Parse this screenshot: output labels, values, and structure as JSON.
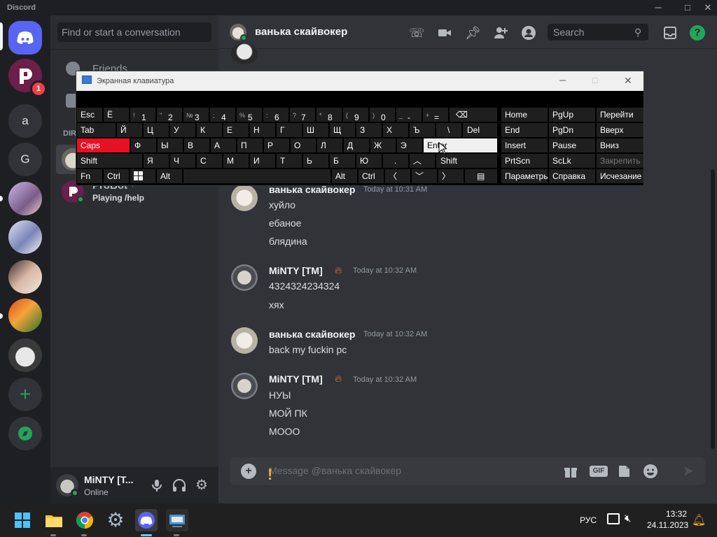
{
  "window": {
    "app_name": "Discord"
  },
  "guilds": {
    "badge": "1",
    "text_icons": [
      "a",
      "G"
    ]
  },
  "sidebar": {
    "search_placeholder": "Find or start a conversation",
    "friends_label": "Friends",
    "dm_header": "DIRE",
    "probot": {
      "name": "ProBot",
      "status": "Playing /help"
    }
  },
  "user_panel": {
    "name": "MiNTY [T...",
    "status": "Online"
  },
  "chat_header": {
    "name": "ванька скайвокер",
    "search_placeholder": "Search"
  },
  "messages": [
    {
      "author": "ванька скайвокер",
      "time": "Today at 10:31 AM",
      "lines": [
        "хуйло",
        "ебаное",
        "блядина"
      ]
    },
    {
      "author": "MiNTY [TM]",
      "time": "Today at 10:32 AM",
      "lines": [
        "4324324234324",
        "хях"
      ]
    },
    {
      "author": "ванька скайвокер",
      "time": "Today at 10:32 AM",
      "lines": [
        "back my fuckin pc"
      ]
    },
    {
      "author": "MiNTY [TM]",
      "time": "Today at 10:32 AM",
      "lines": [
        "НУЫ",
        "МОЙ ПК",
        "МООО"
      ]
    }
  ],
  "composer": {
    "placeholder": "Message @ванька скайвокер",
    "gif": "GIF"
  },
  "osk": {
    "title": "Экранная клавиатура",
    "row1": [
      "Esc",
      "Ё",
      "1",
      "2",
      "3",
      "4",
      "5",
      "6",
      "7",
      "8",
      "9",
      "0",
      "-",
      "="
    ],
    "row1_sub": [
      "",
      "",
      "!",
      "\"",
      "№",
      ";",
      "%",
      ":",
      "?",
      "*",
      "(",
      ")",
      "_",
      "+"
    ],
    "row2": [
      "Tab",
      "Й",
      "Ц",
      "У",
      "К",
      "Е",
      "Н",
      "Г",
      "Ш",
      "Щ",
      "З",
      "Х",
      "Ъ",
      "\\",
      "Del"
    ],
    "row3": [
      "Caps",
      "Ф",
      "Ы",
      "В",
      "А",
      "П",
      "Р",
      "О",
      "Л",
      "Д",
      "Ж",
      "Э",
      "Enter"
    ],
    "row4": [
      "Shift",
      "Я",
      "Ч",
      "С",
      "М",
      "И",
      "Т",
      "Ь",
      "Б",
      "Ю",
      ".",
      "Shift"
    ],
    "row5": [
      "Fn",
      "Ctrl",
      "Alt",
      "Alt",
      "Ctrl"
    ],
    "nav": [
      "Home",
      "PgUp",
      "End",
      "PgDn",
      "Insert",
      "Pause",
      "PrtScn",
      "ScLk",
      "Параметры",
      "Справка"
    ],
    "side": [
      "Перейти",
      "Вверх",
      "Вниз",
      "Закрепить",
      "Исчезание"
    ]
  },
  "taskbar": {
    "lang": "РУС",
    "time": "13:32",
    "date": "24.11.2023"
  }
}
